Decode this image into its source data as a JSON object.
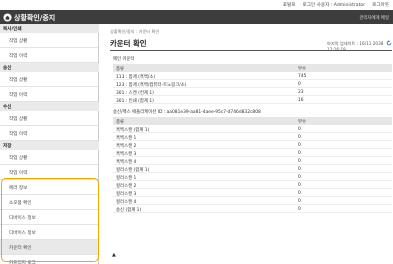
{
  "topbar": {
    "links": [
      "포털로",
      "로그인 사용자 : Administrator",
      "로그아웃"
    ]
  },
  "header": {
    "title": "상황확인/중지",
    "admin_link": "관리자에게 메일"
  },
  "sidebar": {
    "sections": [
      {
        "title": "복사/인쇄",
        "items": [
          "작업 상황",
          "작업 이력"
        ]
      },
      {
        "title": "송신",
        "items": [
          "작업 상황",
          "작업 이력"
        ]
      },
      {
        "title": "수신",
        "items": [
          "작업 상황",
          "작업 이력"
        ]
      },
      {
        "title": "저장",
        "items": [
          "작업 상황",
          "작업 이력"
        ]
      }
    ],
    "extra_items": [
      "에러 정보",
      "소모품 확인",
      "디바이스 정보",
      "디바이스 정보",
      "카운터 확인",
      "카트리지 로그"
    ],
    "active_item": "카운터 확인"
  },
  "main": {
    "breadcrumb": "상황확인/중지 : 카운터 확인",
    "title": "카운터 확인",
    "updated": "마지막 업데이트 : 16/11 2038 12:16:18",
    "machine_counter": {
      "label": "메인 카운터",
      "columns": [
        "종류",
        "부수"
      ],
      "rows": [
        [
          "113 : 합계 (흑백/소)",
          "745"
        ],
        [
          "123 : 합계 (흑백/컴퓨터-트노링크/소)",
          "0"
        ],
        [
          "301 : 스캔 (컨계 1)",
          "23"
        ],
        [
          "301 : 인쇄 (합계 1)",
          "16"
        ]
      ]
    },
    "user_counter": {
      "label": "송신/팩스 애플리케이션 ID : aa081e39-aa81-4aee-95c7-d746d832c808",
      "columns": [
        "종류",
        "부수"
      ],
      "rows": [
        [
          "흑백스캔 (합계 1)",
          "0"
        ],
        [
          "흑백스캔 1",
          "0"
        ],
        [
          "흑백스캔 2",
          "0"
        ],
        [
          "흑백스캔 3",
          "0"
        ],
        [
          "흑백스캔 4",
          "0"
        ],
        [
          "컬러스캔 (합계 1)",
          "0"
        ],
        [
          "컬러스캔 1",
          "0"
        ],
        [
          "컬러스캔 2",
          "0"
        ],
        [
          "컬러스캔 3",
          "0"
        ],
        [
          "컬러스캔 4",
          "0"
        ],
        [
          "송신 (합계 1)",
          "0"
        ]
      ]
    },
    "back_to_top": "▲"
  }
}
